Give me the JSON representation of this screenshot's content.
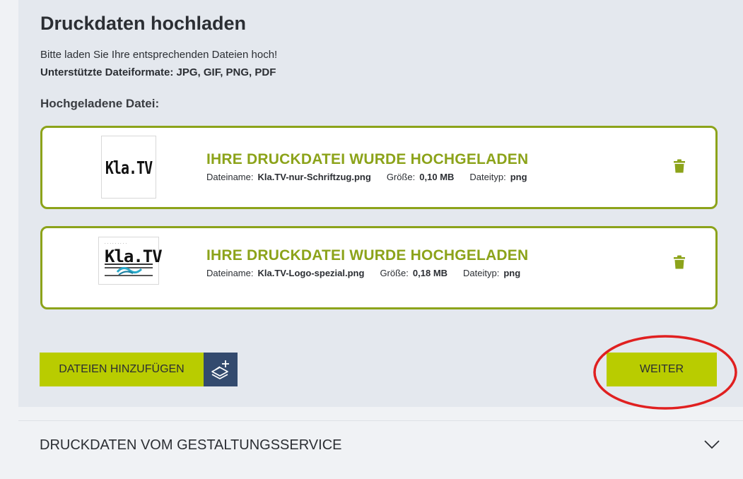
{
  "upload": {
    "title": "Druckdaten hochladen",
    "intro": "Bitte laden Sie Ihre entsprechenden Dateien hoch!",
    "formats": "Unterstützte Dateiformate: JPG, GIF, PNG, PDF",
    "uploaded_heading": "Hochgeladene Datei:",
    "files": [
      {
        "status": "IHRE DRUCKDATEI WURDE HOCHGELADEN",
        "name_label": "Dateiname:",
        "name": "Kla.TV-nur-Schriftzug.png",
        "size_label": "Größe:",
        "size": "0,10 MB",
        "type_label": "Dateityp:",
        "type": "png",
        "thumb_text": "Kla.TV",
        "delete_icon": "trash-icon"
      },
      {
        "status": "IHRE DRUCKDATEI WURDE HOCHGELADEN",
        "name_label": "Dateiname:",
        "name": "Kla.TV-Logo-spezial.png",
        "size_label": "Größe:",
        "size": "0,18 MB",
        "type_label": "Dateityp:",
        "type": "png",
        "thumb_text": "Kla.TV",
        "delete_icon": "trash-icon"
      }
    ],
    "add_button": "DATEIEN HINZUFÜGEN",
    "add_icon": "layers-plus-icon",
    "next_button": "WEITER"
  },
  "accordion": {
    "title": "DRUCKDATEN VOM GESTALTUNGSSERVICE",
    "icon": "chevron-down-icon"
  },
  "colors": {
    "accent": "#b9cc00",
    "card_border": "#8ca31a",
    "status_text": "#8ca31a",
    "icon_box": "#334a6e",
    "highlight": "#e02020",
    "panel_bg": "#e4e8ee"
  }
}
